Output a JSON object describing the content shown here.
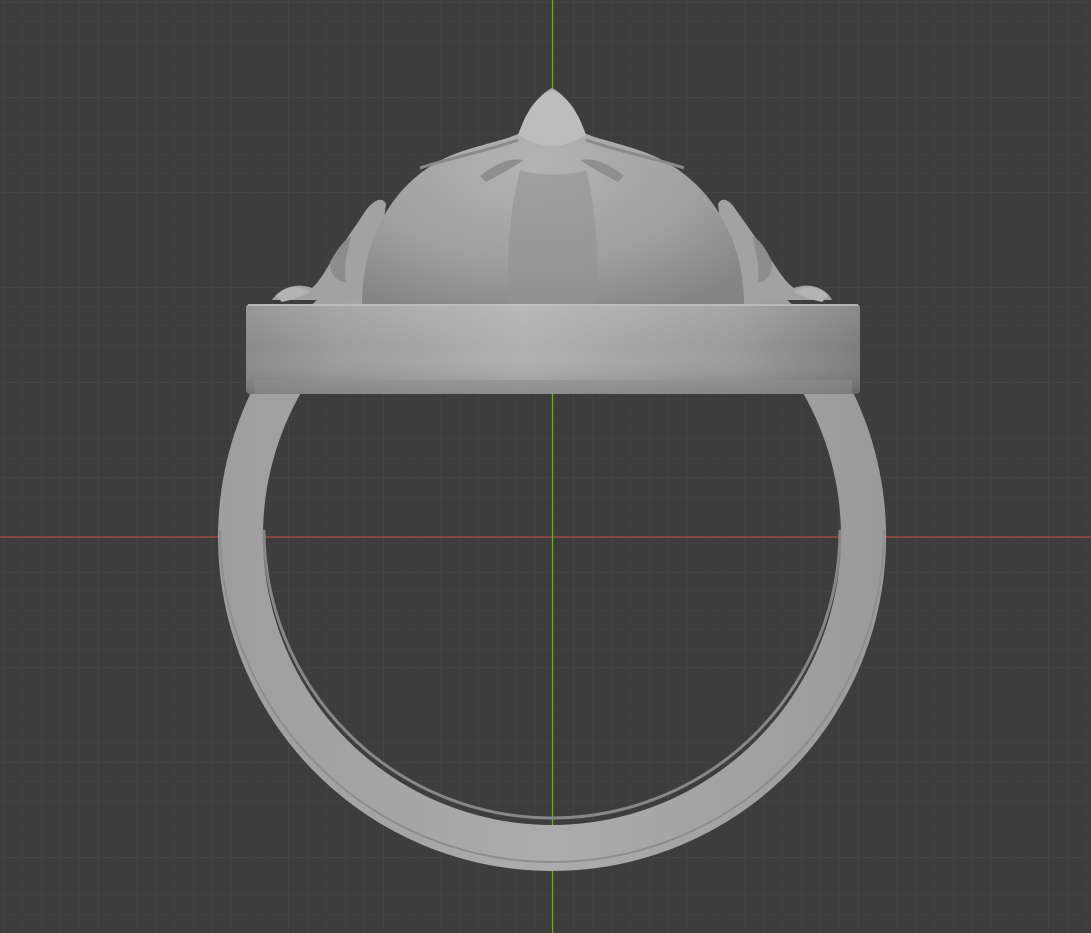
{
  "viewport": {
    "background_color": "#3d3d3d",
    "grid_minor_color": "#454545",
    "grid_major_color": "#4e4e4e",
    "x_axis_color": "#b5474f",
    "y_axis_color": "#70a632",
    "grid_visible": true
  },
  "model": {
    "type": "ring",
    "material_color": "#a8a8a8",
    "parts": [
      "band",
      "bezel",
      "dome"
    ]
  }
}
